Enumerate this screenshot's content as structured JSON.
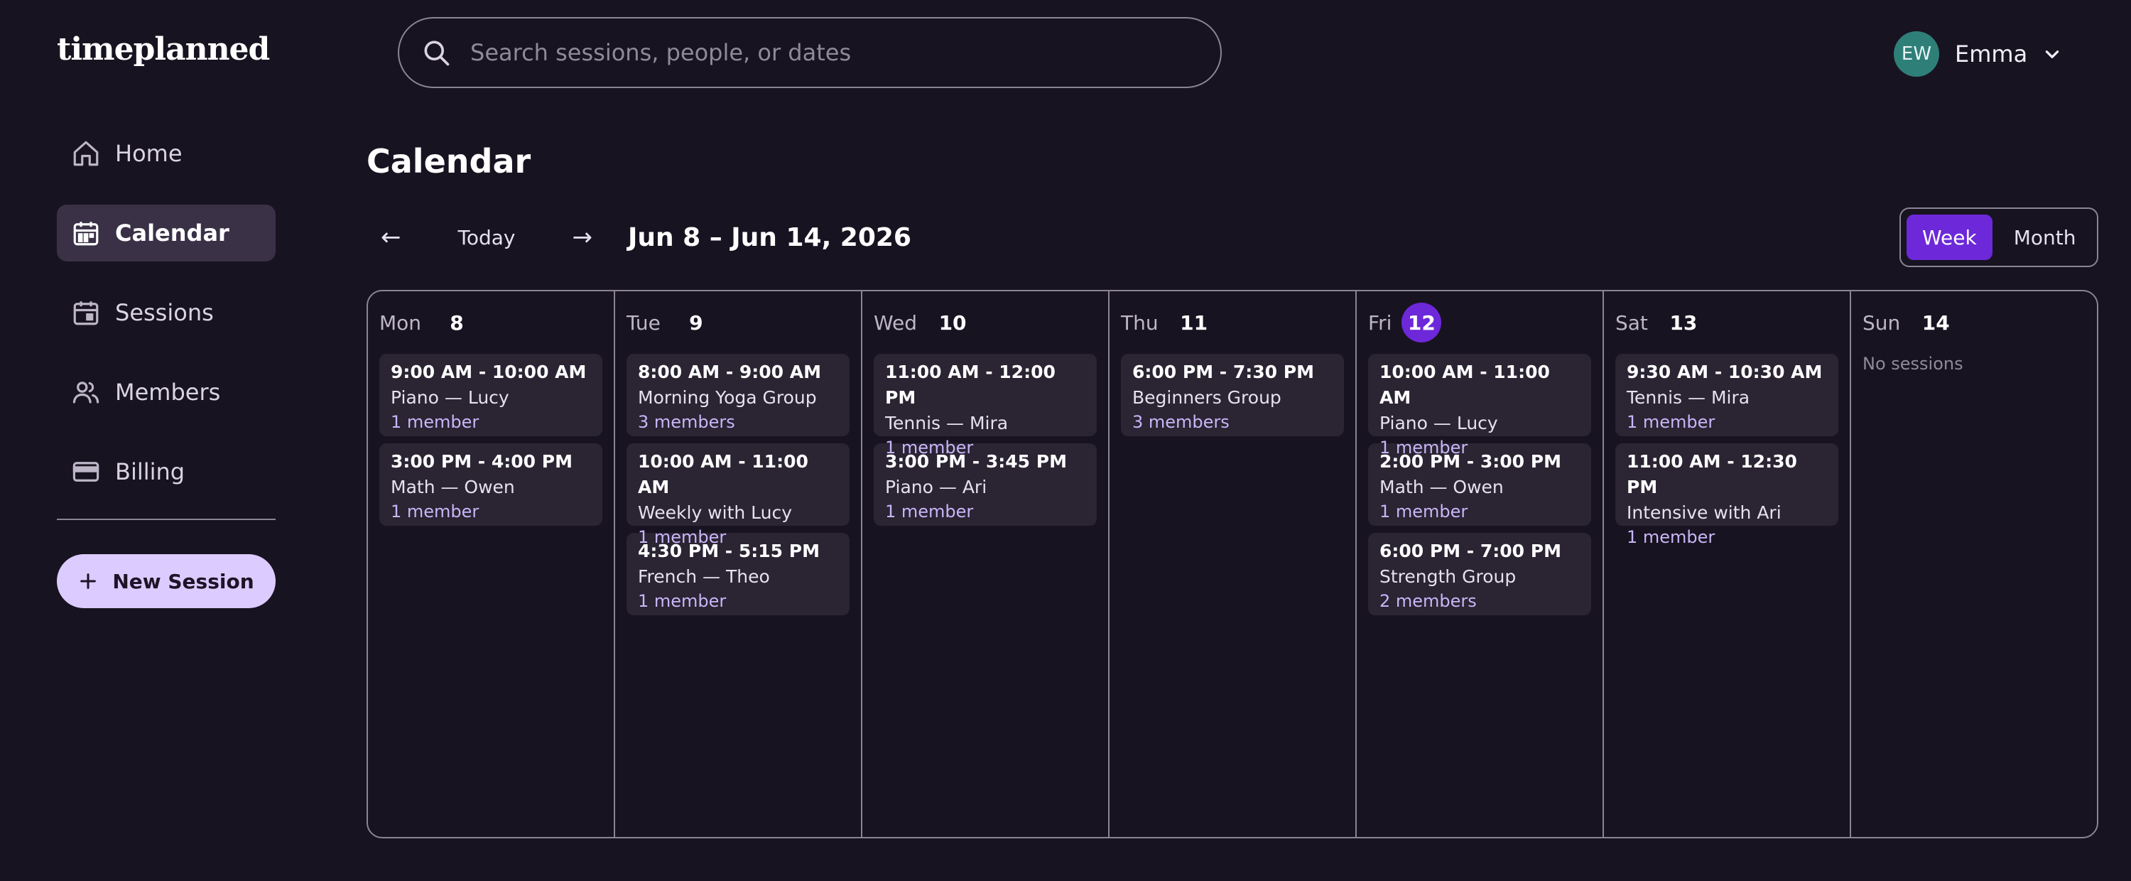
{
  "app": {
    "logo": "timeplanned"
  },
  "search": {
    "placeholder": "Search sessions, people, or dates"
  },
  "user": {
    "initials": "EW",
    "name": "Emma"
  },
  "nav": {
    "items": [
      {
        "label": "Home",
        "icon": "home-icon"
      },
      {
        "label": "Calendar",
        "icon": "calendar-icon"
      },
      {
        "label": "Sessions",
        "icon": "sessions-icon"
      },
      {
        "label": "Members",
        "icon": "members-icon"
      },
      {
        "label": "Billing",
        "icon": "billing-icon"
      }
    ],
    "active": "Calendar",
    "new_session_label": "New Session"
  },
  "page": {
    "title": "Calendar"
  },
  "toolbar": {
    "prev": "←",
    "today": "Today",
    "next": "→",
    "range": "Jun 8 – Jun 14, 2026",
    "views": [
      "Week",
      "Month"
    ],
    "active_view": "Week"
  },
  "colors": {
    "accent": "#6d28d9",
    "background": "#181320",
    "card": "#2a2433",
    "members_text": "#c7b6f7"
  },
  "days": [
    {
      "dow": "Mon",
      "num": "8",
      "sessions": [
        {
          "time": "9:00 AM - 10:00 AM",
          "title": "Piano — Lucy",
          "members": "1 member"
        },
        {
          "time": "3:00 PM - 4:00 PM",
          "title": "Math — Owen",
          "members": "1 member"
        }
      ]
    },
    {
      "dow": "Tue",
      "num": "9",
      "sessions": [
        {
          "time": "8:00 AM - 9:00 AM",
          "title": "Morning Yoga Group",
          "members": "3 members"
        },
        {
          "time": "10:00 AM - 11:00 AM",
          "title": "Weekly with Lucy",
          "members": "1 member"
        },
        {
          "time": "4:30 PM - 5:15 PM",
          "title": "French — Theo",
          "members": "1 member"
        }
      ]
    },
    {
      "dow": "Wed",
      "num": "10",
      "sessions": [
        {
          "time": "11:00 AM - 12:00 PM",
          "title": "Tennis — Mira",
          "members": "1 member"
        },
        {
          "time": "3:00 PM - 3:45 PM",
          "title": "Piano — Ari",
          "members": "1 member"
        }
      ]
    },
    {
      "dow": "Thu",
      "num": "11",
      "sessions": [
        {
          "time": "6:00 PM - 7:30 PM",
          "title": "Beginners Group",
          "members": "3 members"
        }
      ]
    },
    {
      "dow": "Fri",
      "num": "12",
      "today": true,
      "sessions": [
        {
          "time": "10:00 AM - 11:00 AM",
          "title": "Piano — Lucy",
          "members": "1 member"
        },
        {
          "time": "2:00 PM - 3:00 PM",
          "title": "Math — Owen",
          "members": "1 member"
        },
        {
          "time": "6:00 PM - 7:00 PM",
          "title": "Strength Group",
          "members": "2 members"
        }
      ]
    },
    {
      "dow": "Sat",
      "num": "13",
      "sessions": [
        {
          "time": "9:30 AM - 10:30 AM",
          "title": "Tennis — Mira",
          "members": "1 member"
        },
        {
          "time": "11:00 AM - 12:30 PM",
          "title": "Intensive with Ari",
          "members": "1 member"
        }
      ]
    },
    {
      "dow": "Sun",
      "num": "14",
      "sessions": [],
      "empty_text": "No sessions"
    }
  ]
}
